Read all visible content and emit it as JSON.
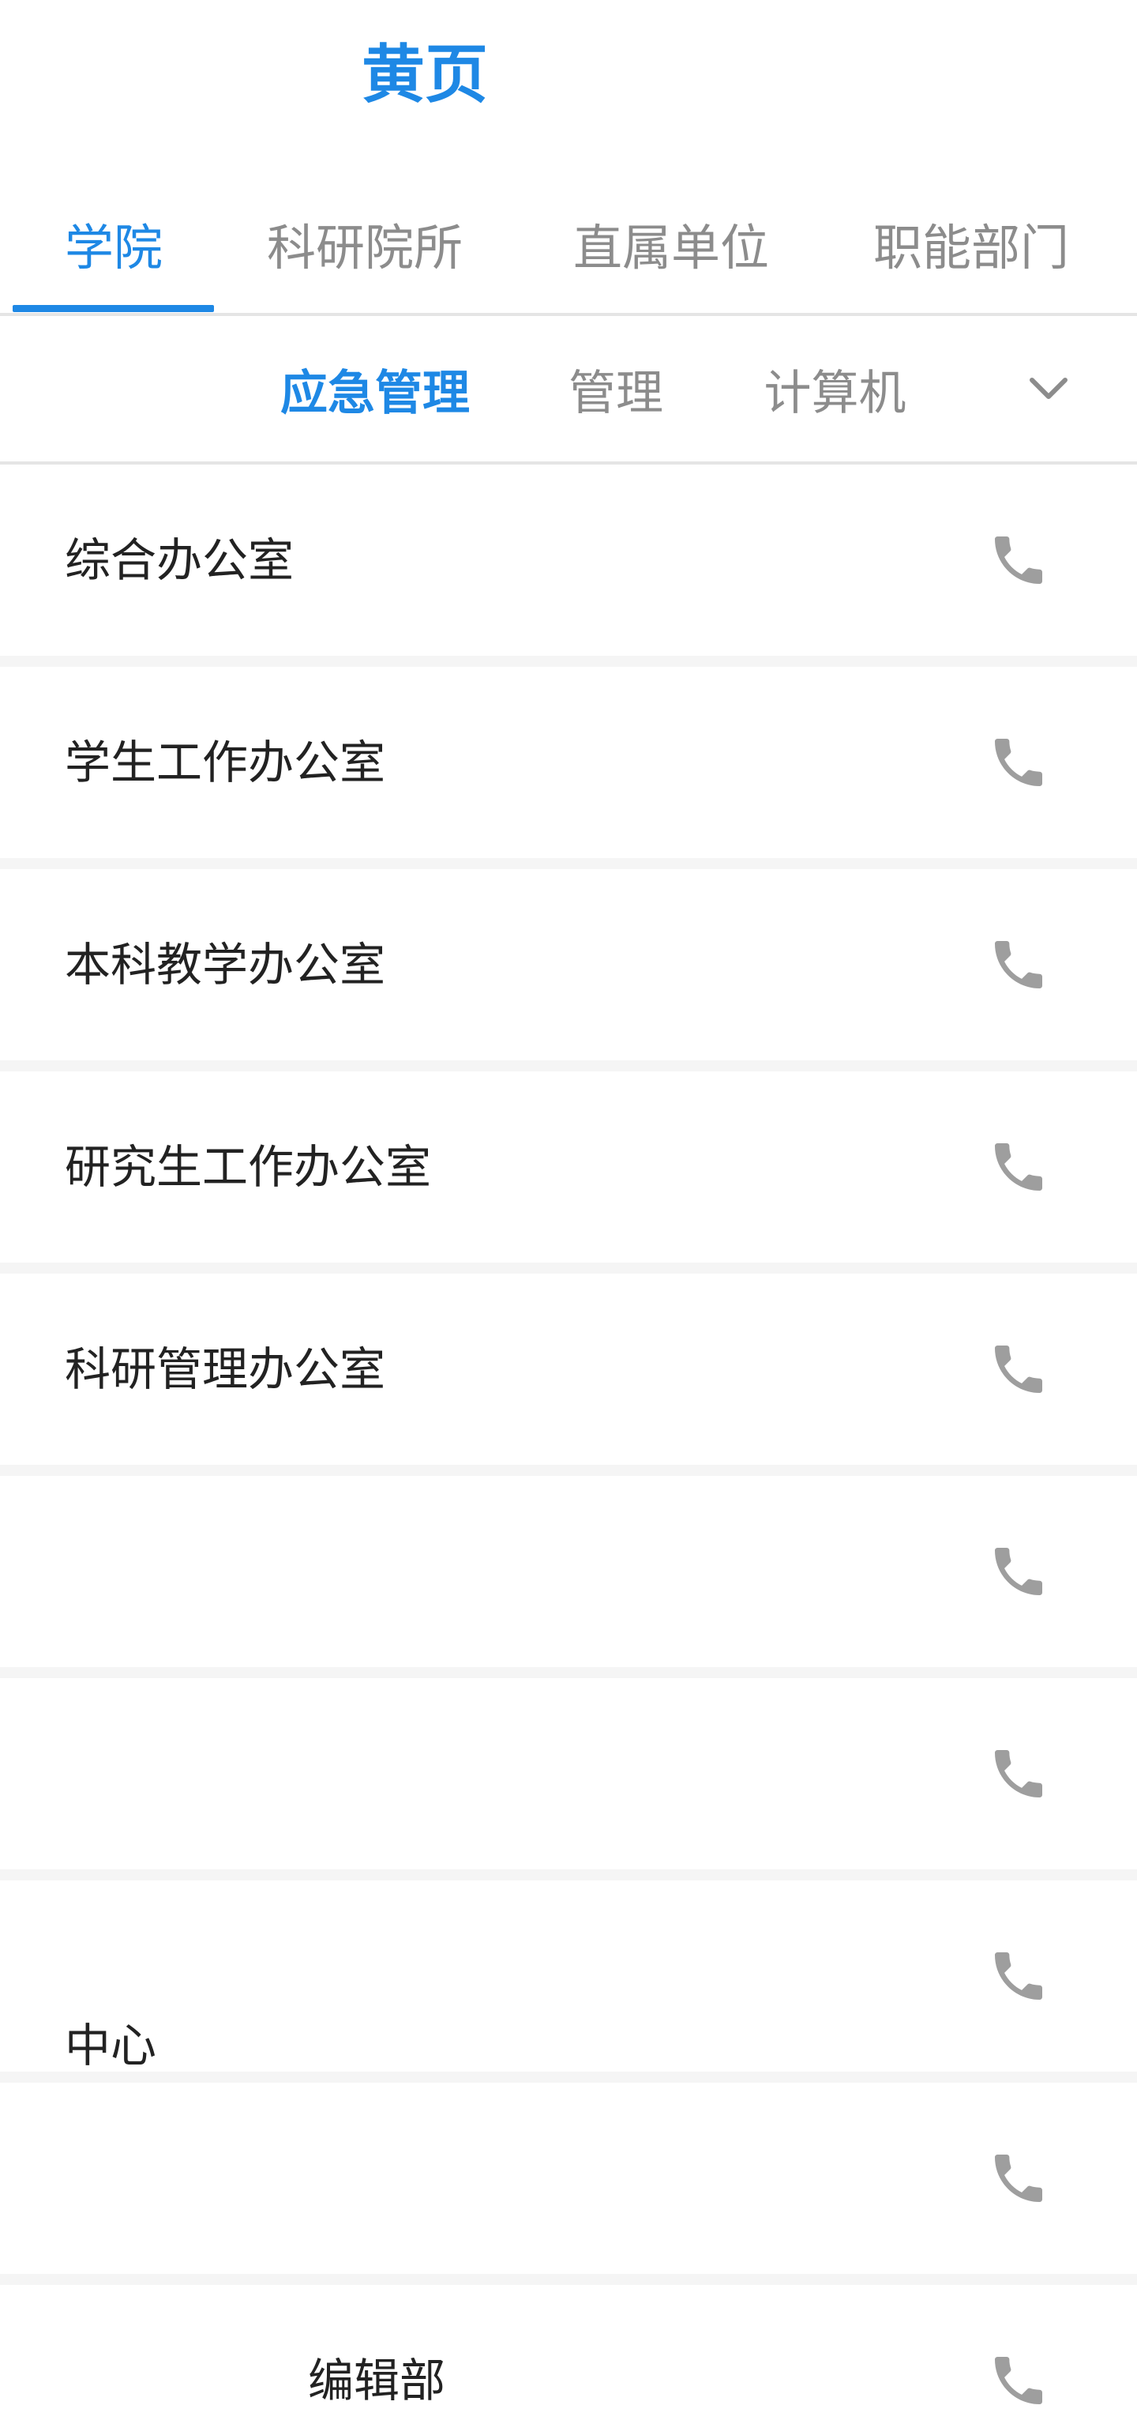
{
  "header": {
    "title": "黄页"
  },
  "primary_tabs": [
    {
      "label": "学院",
      "active": true
    },
    {
      "label": "科研院所",
      "active": false
    },
    {
      "label": "直属单位",
      "active": false
    },
    {
      "label": "职能部门",
      "active": false
    }
  ],
  "secondary_tabs": [
    {
      "label": "应急管理",
      "active": true
    },
    {
      "label": "管理",
      "active": false
    },
    {
      "label": "计算机",
      "active": false
    }
  ],
  "expand_icon": "chevron-down-icon",
  "contacts": [
    {
      "name": "综合办公室",
      "icon": "phone-icon"
    },
    {
      "name": "学生工作办公室",
      "icon": "phone-icon"
    },
    {
      "name": "本科教学办公室",
      "icon": "phone-icon"
    },
    {
      "name": "研究生工作办公室",
      "icon": "phone-icon"
    },
    {
      "name": "科研管理办公室",
      "icon": "phone-icon"
    },
    {
      "name": "",
      "icon": "phone-icon"
    },
    {
      "name": "",
      "icon": "phone-icon"
    },
    {
      "name": "中心",
      "icon": "phone-icon"
    },
    {
      "name": "",
      "icon": "phone-icon"
    },
    {
      "name": "编辑部",
      "icon": "phone-icon"
    }
  ],
  "colors": {
    "accent": "#1e88e5",
    "inactive_text": "#8c8c8c",
    "primary_text": "#222222",
    "icon_gray": "#9e9e9e",
    "divider": "#e5e5e5",
    "list_gap": "#f5f5f5"
  }
}
